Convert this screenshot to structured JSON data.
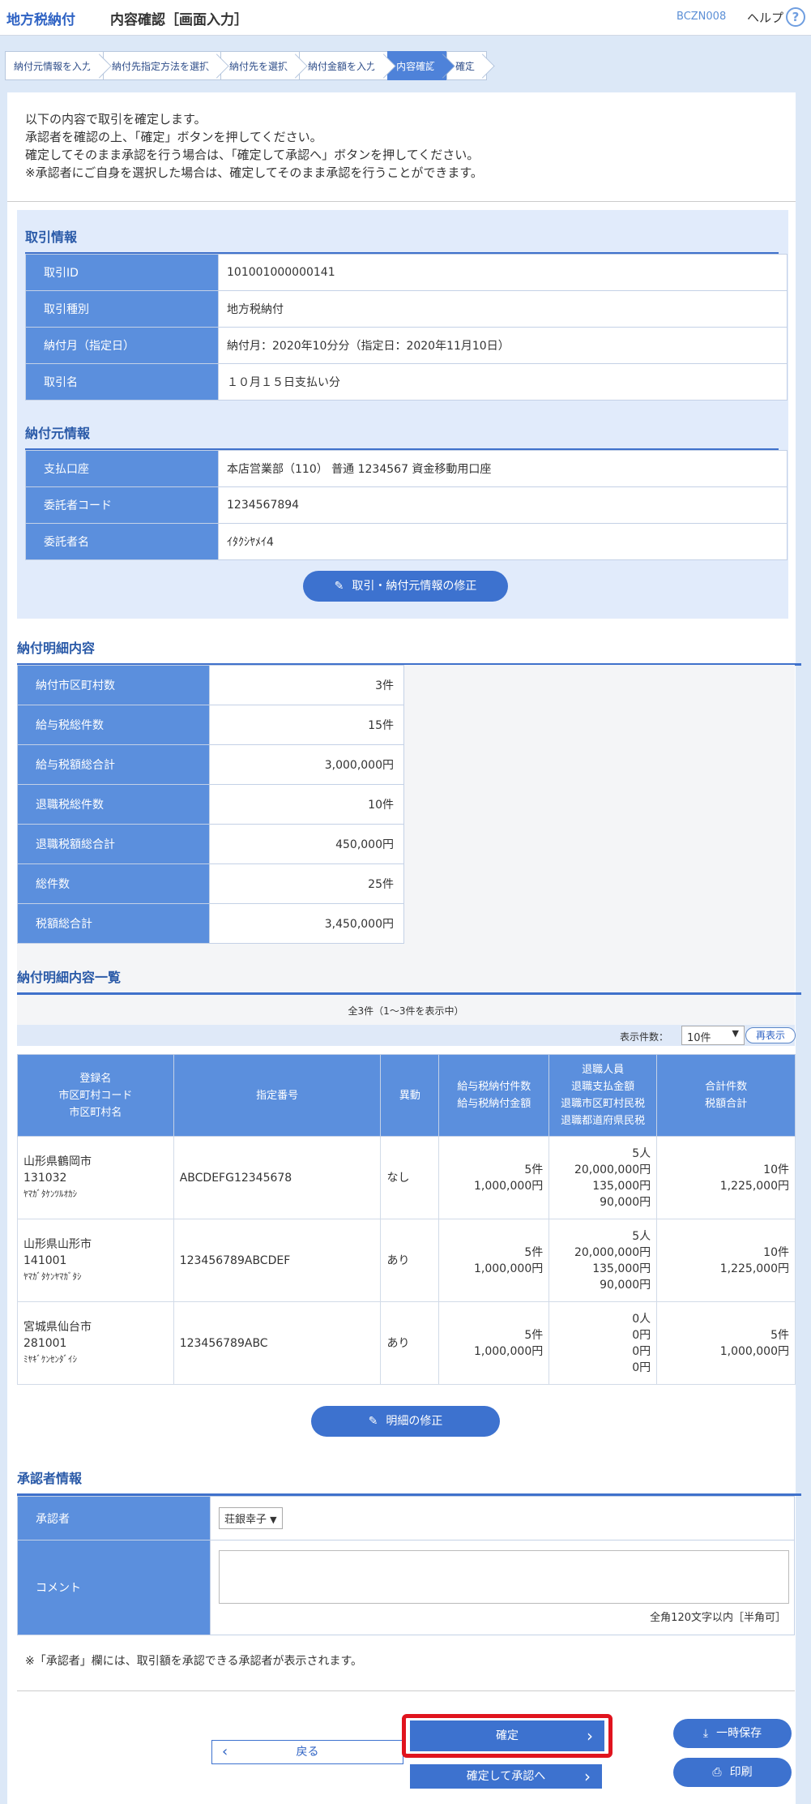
{
  "header": {
    "brand": "地方税納付",
    "title": "内容確認［画面入力］",
    "screen_code": "BCZN008",
    "help": "ヘルプ",
    "help_icon": "?"
  },
  "steps": [
    "納付元情報を入力",
    "納付先指定方法を選択",
    "納付先を選択",
    "納付金額を入力",
    "内容確認",
    "確定"
  ],
  "active_step": 4,
  "intro": {
    "lines": [
      "以下の内容で取引を確定します。",
      "承認者を確認の上、「確定」ボタンを押してください。",
      "確定してそのまま承認を行う場合は、「確定して承認へ」ボタンを押してください。",
      "※承認者にご自身を選択した場合は、確定してそのまま承認を行うことができます。"
    ]
  },
  "transaction": {
    "title": "取引情報",
    "rows": [
      {
        "k": "取引ID",
        "v": "101001000000141"
      },
      {
        "k": "取引種別",
        "v": "地方税納付"
      },
      {
        "k": "納付月（指定日）",
        "v": "納付月：2020年10分分（指定日：2020年11月10日）"
      },
      {
        "k": "取引名",
        "v": "１０月１５日支払い分"
      }
    ]
  },
  "payer": {
    "title": "納付元情報",
    "rows": [
      {
        "k": "支払口座",
        "v": "本店営業部（110） 普通 1234567 資金移動用口座"
      },
      {
        "k": "委託者コード",
        "v": "1234567894"
      },
      {
        "k": "委託者名",
        "v": "ｲﾀｸｼﾔﾒｲ4"
      }
    ]
  },
  "modify_info_button": "取引・納付元情報の修正",
  "summary": {
    "title": "納付明細内容",
    "rows": [
      {
        "k": "納付市区町村数",
        "v": "3件"
      },
      {
        "k": "給与税総件数",
        "v": "15件"
      },
      {
        "k": "給与税額総合計",
        "v": "3,000,000円"
      },
      {
        "k": "退職税総件数",
        "v": "10件"
      },
      {
        "k": "退職税額総合計",
        "v": "450,000円"
      },
      {
        "k": "総件数",
        "v": "25件"
      },
      {
        "k": "税額総合計",
        "v": "3,450,000円"
      }
    ]
  },
  "list": {
    "title": "納付明細内容一覧",
    "count_text": "全3件（1～3件を表示中）",
    "display_label": "表示件数：",
    "display_value": "10件",
    "redisplay": "再表示",
    "headers": [
      [
        "登録名",
        "市区町村コード",
        "市区町村名"
      ],
      [
        "指定番号"
      ],
      [
        "異動"
      ],
      [
        "給与税納付件数",
        "給与税納付金額"
      ],
      [
        "退職人員",
        "退職支払金額",
        "退職市区町村民税",
        "退職都道府県民税"
      ],
      [
        "合計件数",
        "税額合計"
      ]
    ],
    "rows": [
      {
        "name": "山形県鶴岡市",
        "code": "131032",
        "kana": "ﾔﾏｶﾞﾀｹﾝﾂﾙｵｶｼ",
        "num": "ABCDEFG12345678",
        "change": "なし",
        "sal_n": "5件",
        "sal_a": "1,000,000円",
        "ret": [
          "5人",
          "20,000,000円",
          "135,000円",
          "90,000円"
        ],
        "tot_n": "10件",
        "tot_a": "1,225,000円"
      },
      {
        "name": "山形県山形市",
        "code": "141001",
        "kana": "ﾔﾏｶﾞﾀｹﾝﾔﾏｶﾞﾀｼ",
        "num": "123456789ABCDEF",
        "change": "あり",
        "sal_n": "5件",
        "sal_a": "1,000,000円",
        "ret": [
          "5人",
          "20,000,000円",
          "135,000円",
          "90,000円"
        ],
        "tot_n": "10件",
        "tot_a": "1,225,000円"
      },
      {
        "name": "宮城県仙台市",
        "code": "281001",
        "kana": "ﾐﾔｷﾞｹﾝｾﾝﾀﾞｲｼ",
        "num": "123456789ABC",
        "change": "あり",
        "sal_n": "5件",
        "sal_a": "1,000,000円",
        "ret": [
          "0人",
          "0円",
          "0円",
          "0円"
        ],
        "tot_n": "5件",
        "tot_a": "1,000,000円"
      }
    ]
  },
  "modify_detail_button": "明細の修正",
  "approver": {
    "title": "承認者情報",
    "label": "承認者",
    "value": "荘銀幸子",
    "comment_label": "コメント",
    "comment_value": "",
    "comment_hint": "全角120文字以内［半角可］",
    "note": "※「承認者」欄には、取引額を承認できる承認者が表示されます。"
  },
  "buttons": {
    "back": "戻る",
    "confirm": "確定",
    "confirm_approve": "確定して承認へ",
    "save": "一時保存",
    "print": "印刷"
  },
  "colors": {
    "accent": "#3d72cf",
    "header_cell": "#5b8fdd",
    "highlight": "#e0141e"
  }
}
